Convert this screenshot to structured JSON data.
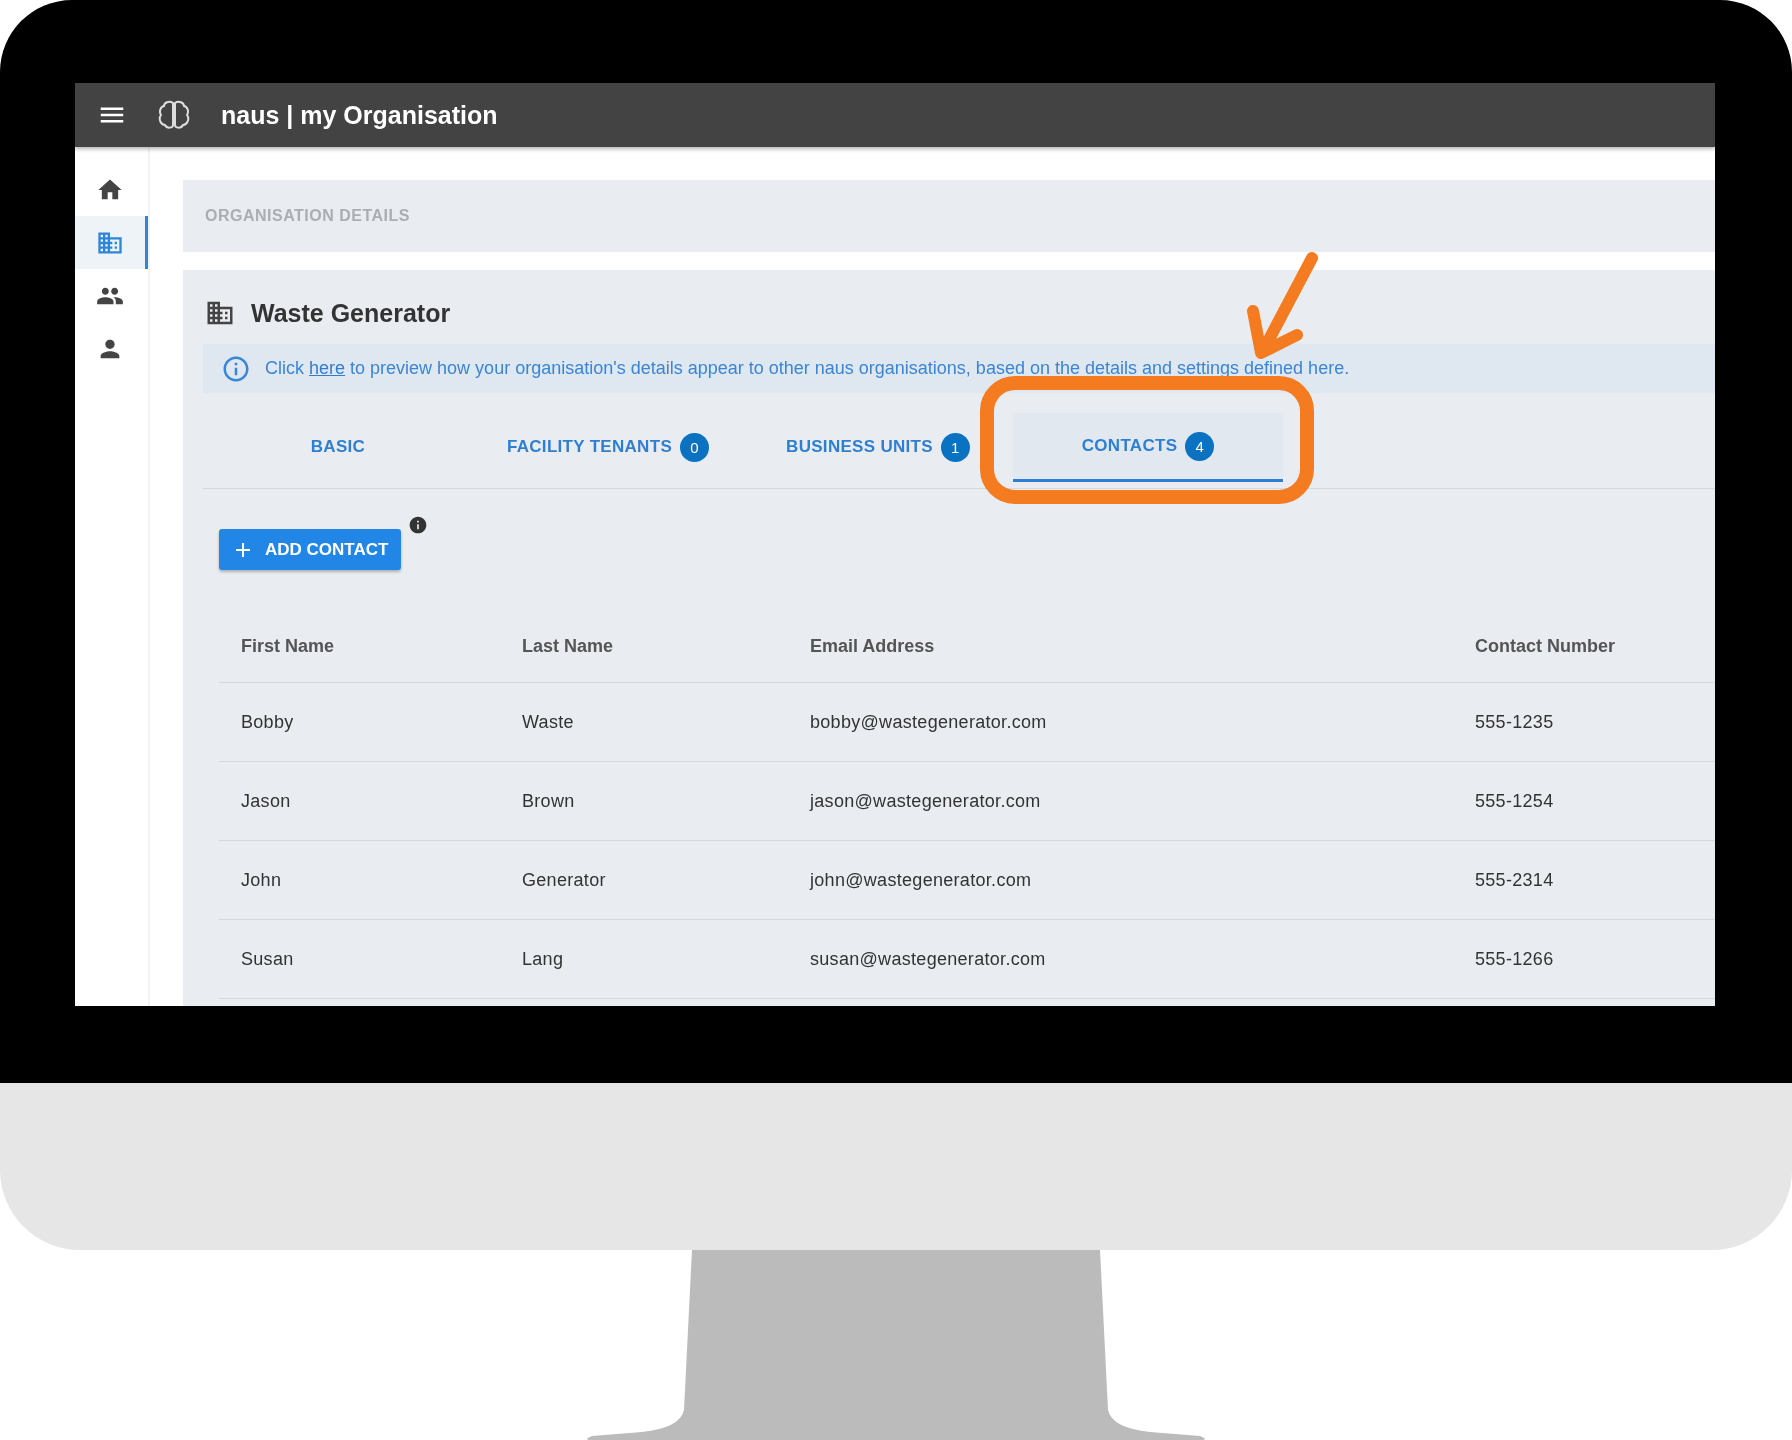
{
  "app": {
    "title": "naus | my Organisation"
  },
  "sidebar": {
    "items": [
      {
        "kind": "home",
        "selected": false
      },
      {
        "kind": "building",
        "selected": true
      },
      {
        "kind": "people",
        "selected": false
      },
      {
        "kind": "person",
        "selected": false
      }
    ]
  },
  "breadcrumb": "ORGANISATION DETAILS",
  "organisation": {
    "name": "Waste Generator"
  },
  "info": {
    "before": "Click",
    "link": "here",
    "after": "to preview how your organisation's details appear to other naus organisations, based on the details and settings defined here."
  },
  "tabs": [
    {
      "label": "BASIC",
      "selected": false
    },
    {
      "label": "FACILITY TENANTS",
      "count": "0",
      "selected": false
    },
    {
      "label": "BUSINESS UNITS",
      "count": "1",
      "selected": false
    },
    {
      "label": "CONTACTS",
      "count": "4",
      "selected": true
    }
  ],
  "add_button": "ADD CONTACT",
  "table": {
    "columns": [
      "First Name",
      "Last Name",
      "Email Address",
      "Contact Number"
    ],
    "rows": [
      [
        "Bobby",
        "Waste",
        "bobby@wastegenerator.com",
        "555-1235"
      ],
      [
        "Jason",
        "Brown",
        "jason@wastegenerator.com",
        "555-1254"
      ],
      [
        "John",
        "Generator",
        "john@wastegenerator.com",
        "555-2314"
      ],
      [
        "Susan",
        "Lang",
        "susan@wastegenerator.com",
        "555-1266"
      ]
    ]
  }
}
